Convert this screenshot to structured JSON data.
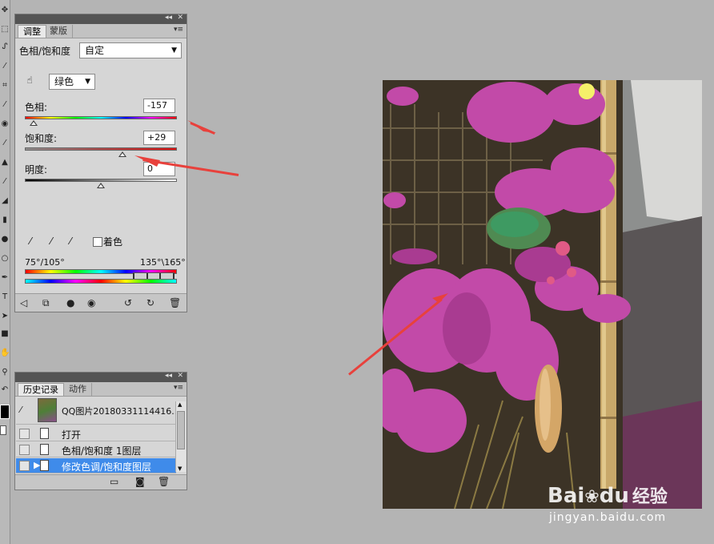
{
  "tools": [
    "move-icon",
    "marquee-icon",
    "lasso-icon",
    "magic-wand-icon",
    "crop-icon",
    "eyedropper-icon",
    "healing-icon",
    "brush-icon",
    "stamp-icon",
    "history-brush-icon",
    "eraser-icon",
    "gradient-icon",
    "blur-icon",
    "dodge-icon",
    "pen-icon",
    "type-icon",
    "path-select-icon",
    "shape-icon",
    "hand-icon",
    "zoom-icon"
  ],
  "adjustments_panel": {
    "tabs": [
      "调整",
      "蒙版"
    ],
    "title": "色相/饱和度",
    "preset": "自定",
    "channel": "绿色",
    "hue_label": "色相:",
    "hue_value": "-157",
    "hue_slider_fraction": 0.06,
    "saturation_label": "饱和度:",
    "saturation_value": "+29",
    "saturation_slider_fraction": 0.64,
    "lightness_label": "明度:",
    "lightness_value": "0",
    "lightness_slider_fraction": 0.5,
    "colorize_label": "着色",
    "colorize_checked": false,
    "range_left": "75°/105°",
    "range_right": "135°\\165°"
  },
  "history_panel": {
    "tabs": [
      "历史记录",
      "动作"
    ],
    "snapshot": "QQ图片20180331114416...",
    "items": [
      "打开",
      "色相/饱和度 1图层",
      "修改色调/饱和度图层"
    ],
    "selected_index": 2
  },
  "watermark": {
    "brand_a": "Bai",
    "brand_b": "du",
    "product": "经验",
    "url": "jingyan.baidu.com"
  },
  "colors": {
    "annotation_arrow": "#e8413c",
    "selected_row": "#3f8bea",
    "panel_bg": "#d6d6d6",
    "workspace_bg": "#b4b4b4"
  }
}
